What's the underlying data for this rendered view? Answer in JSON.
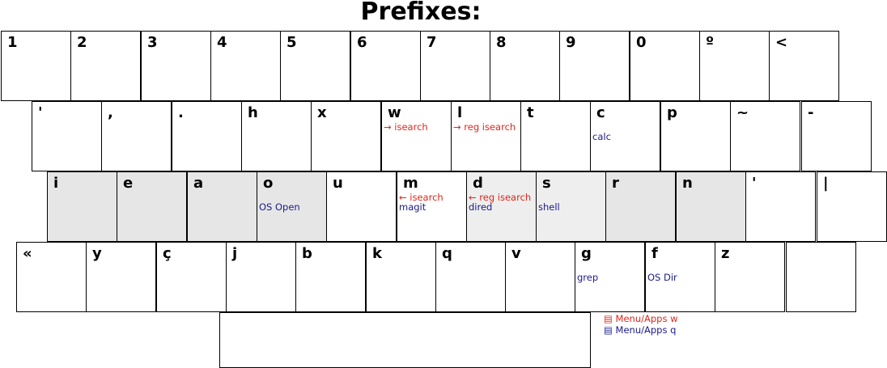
{
  "title": "Prefixes:",
  "colors": {
    "red": "#e0261c",
    "blue": "#1a1a8c",
    "gray_key": "#e6e6e6",
    "light_key": "#eeeeee"
  },
  "rows": [
    {
      "keys": [
        {
          "label": "1"
        },
        {
          "label": "2"
        },
        {
          "label": "3"
        },
        {
          "label": "4"
        },
        {
          "label": "5"
        },
        {
          "label": "6"
        },
        {
          "label": "7"
        },
        {
          "label": "8"
        },
        {
          "label": "9"
        },
        {
          "label": "0"
        },
        {
          "label": "º"
        },
        {
          "label": "<"
        }
      ]
    },
    {
      "keys": [
        {
          "label": "'"
        },
        {
          "label": ","
        },
        {
          "label": "."
        },
        {
          "label": "h"
        },
        {
          "label": "x"
        },
        {
          "label": "w",
          "line1": "→ isearch",
          "line1_color": "red"
        },
        {
          "label": "l",
          "line1": "→ reg isearch",
          "line1_color": "red"
        },
        {
          "label": "t"
        },
        {
          "label": "c",
          "line2": "calc",
          "line2_color": "blue"
        },
        {
          "label": "p"
        },
        {
          "label": "~"
        },
        {
          "label": "-"
        }
      ]
    },
    {
      "keys": [
        {
          "label": "i",
          "shade": "gray"
        },
        {
          "label": "e",
          "shade": "gray"
        },
        {
          "label": "a",
          "shade": "gray"
        },
        {
          "label": "o",
          "shade": "gray",
          "line2": "OS Open",
          "line2_color": "blue"
        },
        {
          "label": "u"
        },
        {
          "label": "m",
          "line1": "← isearch",
          "line1_color": "red",
          "line2": "magit",
          "line2_color": "blue"
        },
        {
          "label": "d",
          "shade": "light",
          "line1": "← reg isearch",
          "line1_color": "red",
          "line2": "dired",
          "line2_color": "blue"
        },
        {
          "label": "s",
          "shade": "light",
          "line2": "shell",
          "line2_color": "blue"
        },
        {
          "label": "r",
          "shade": "gray"
        },
        {
          "label": "n",
          "shade": "gray"
        },
        {
          "label": "'"
        },
        {
          "label": "|"
        }
      ]
    },
    {
      "keys": [
        {
          "label": "«"
        },
        {
          "label": "y"
        },
        {
          "label": "ç"
        },
        {
          "label": "j"
        },
        {
          "label": "b"
        },
        {
          "label": "k"
        },
        {
          "label": "q"
        },
        {
          "label": "v"
        },
        {
          "label": "g",
          "line2": "grep",
          "line2_color": "blue"
        },
        {
          "label": "f",
          "line2": "OS Dir",
          "line2_color": "blue"
        },
        {
          "label": "z"
        },
        {
          "label": ""
        }
      ]
    }
  ],
  "spacebar": {
    "label": ""
  },
  "legend": [
    {
      "icon": "menu-icon",
      "glyph": "▤",
      "text": "Menu/Apps w",
      "color": "red"
    },
    {
      "icon": "menu-icon",
      "glyph": "▤",
      "text": "Menu/Apps q",
      "color": "blue"
    }
  ]
}
